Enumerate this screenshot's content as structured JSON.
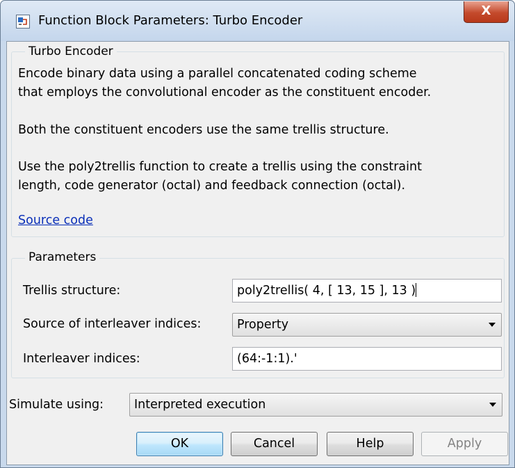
{
  "window": {
    "title": "Function Block Parameters: Turbo Encoder",
    "close_glyph": "X"
  },
  "description": {
    "group_title": "Turbo Encoder",
    "lines": [
      "Encode binary data using a parallel concatenated coding scheme",
      "that employs the convolutional encoder as the constituent encoder.",
      "",
      "Both the constituent encoders use the same trellis structure.",
      "",
      "Use the poly2trellis function to create a trellis using the constraint",
      "length, code generator (octal) and feedback connection (octal)."
    ],
    "link_text": "Source code"
  },
  "parameters": {
    "group_title": "Parameters",
    "trellis": {
      "label": "Trellis structure:",
      "value": "poly2trellis( 4, [ 13, 15 ], 13 )"
    },
    "source": {
      "label": "Source of interleaver indices:",
      "value": "Property"
    },
    "indices": {
      "label": "Interleaver indices:",
      "value": "(64:-1:1).'"
    }
  },
  "simulate": {
    "label": "Simulate using:",
    "value": "Interpreted execution"
  },
  "buttons": {
    "ok": "OK",
    "cancel": "Cancel",
    "help": "Help",
    "apply": "Apply"
  },
  "icons": {
    "app": "simulink-block-icon",
    "close": "close-icon",
    "dropdown": "chevron-down-icon"
  }
}
